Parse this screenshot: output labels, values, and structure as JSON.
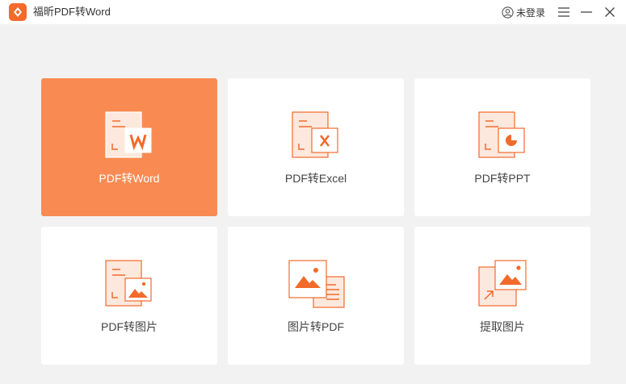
{
  "app": {
    "title": "福昕PDF转Word",
    "login_label": "未登录"
  },
  "colors": {
    "accent": "#f98b52",
    "icon_stroke": "#f26b2b",
    "icon_fill": "#fde8dd"
  },
  "cards": [
    {
      "label": "PDF转Word",
      "icon": "pdf-to-word-icon",
      "active": true
    },
    {
      "label": "PDF转Excel",
      "icon": "pdf-to-excel-icon",
      "active": false
    },
    {
      "label": "PDF转PPT",
      "icon": "pdf-to-ppt-icon",
      "active": false
    },
    {
      "label": "PDF转图片",
      "icon": "pdf-to-image-icon",
      "active": false
    },
    {
      "label": "图片转PDF",
      "icon": "image-to-pdf-icon",
      "active": false
    },
    {
      "label": "提取图片",
      "icon": "extract-image-icon",
      "active": false
    }
  ]
}
